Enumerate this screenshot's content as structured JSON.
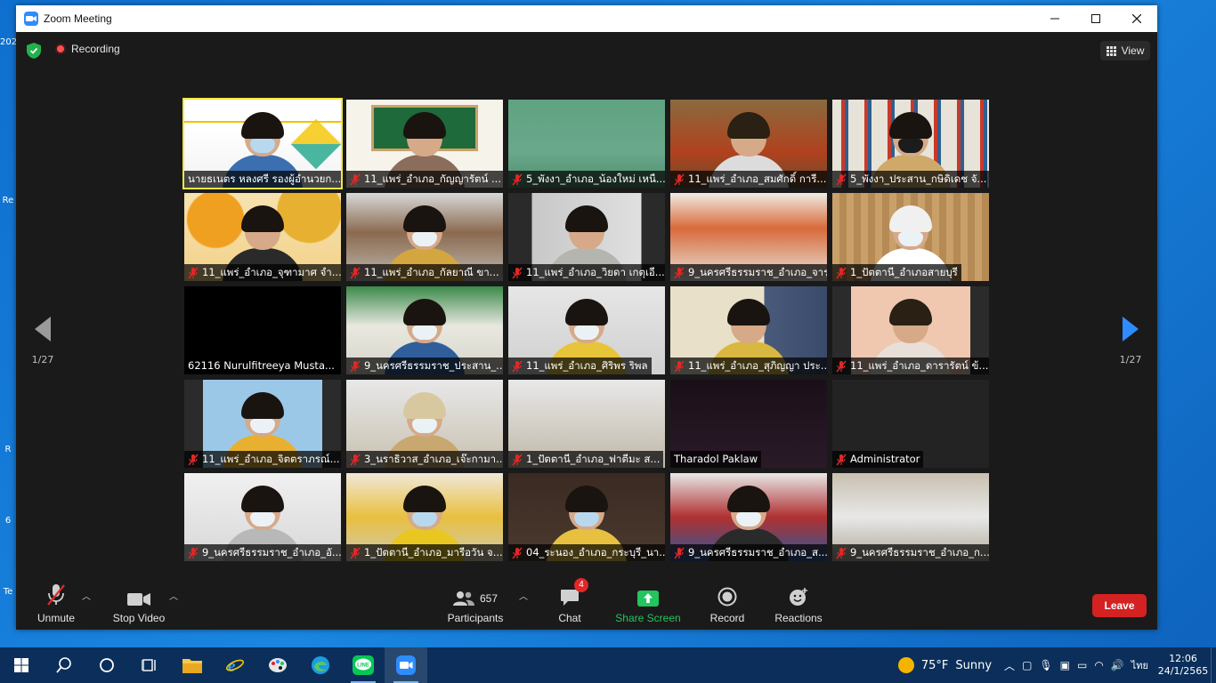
{
  "window": {
    "title": "Zoom Meeting"
  },
  "topbar": {
    "recording_label": "Recording",
    "view_label": "View"
  },
  "nav": {
    "page_left": "1/27",
    "page_right": "1/27"
  },
  "tiles": [
    {
      "name": "นายธเนตร หลงศรี รองผู้อำนวยก...",
      "muted": false,
      "scene": "slide"
    },
    {
      "name": "11_แพร่_อำเภอ_กัญญารัตน์ ...",
      "muted": true,
      "scene": "board"
    },
    {
      "name": "5_พังงา_อำเภอ_น้องใหม่ เหนื...",
      "muted": true,
      "scene": "green"
    },
    {
      "name": "11_แพร่_อำเภอ_สมศักดิ์ การี...",
      "muted": true,
      "scene": "temple"
    },
    {
      "name": "5_พังงา_ประสาน_กษิดิเดช จั...",
      "muted": true,
      "scene": "books"
    },
    {
      "name": "11_แพร่_อำเภอ_จุฑามาศ จำ...",
      "muted": true,
      "scene": "autumn"
    },
    {
      "name": "11_แพร่_อำเภอ_กัลยาณี ขา...",
      "muted": true,
      "scene": "room"
    },
    {
      "name": "11_แพร่_อำเภอ_วิยดา เกตุเอี...",
      "muted": true,
      "scene": "office"
    },
    {
      "name": "9_นครศรีธรรมราช_อำเภอ_จารุ...",
      "muted": true,
      "scene": "shelf"
    },
    {
      "name": "1_ปัตตานี_อำเภอสายบุรี",
      "muted": true,
      "scene": "curtain"
    },
    {
      "name": "62116 Nurulfitreeya Musta...",
      "muted": false,
      "scene": "black"
    },
    {
      "name": "9_นครศรีธรรมราช_ประสาน_...",
      "muted": true,
      "scene": "poster"
    },
    {
      "name": "11_แพร่_อำเภอ_ศิริพร ริพล",
      "muted": true,
      "scene": "office2"
    },
    {
      "name": "11_แพร่_อำเภอ_สุภิญญา ประ...",
      "muted": true,
      "scene": "files"
    },
    {
      "name": "11_แพร่_อำเภอ_ดารารัตน์ ข้...",
      "muted": true,
      "scene": "pink"
    },
    {
      "name": "11_แพร่_อำเภอ_จิตตราภรณ์...",
      "muted": true,
      "scene": "window"
    },
    {
      "name": "3_นราธิวาส_อำเภอ_เจ๊ะกามา...",
      "muted": true,
      "scene": "hall"
    },
    {
      "name": "1_ปัตตานี_อำเภอ_ฟาตีมะ ส...",
      "muted": true,
      "scene": "ceiling"
    },
    {
      "name": "Tharadol Paklaw",
      "muted": false,
      "scene": "dark"
    },
    {
      "name": "Administrator",
      "muted": true,
      "scene": "empty"
    },
    {
      "name": "9_นครศรีธรรมราช_อำเภอ_อั...",
      "muted": true,
      "scene": "wall"
    },
    {
      "name": "1_ปัตตานี_อำเภอ_มารีอวัน จ...",
      "muted": true,
      "scene": "class"
    },
    {
      "name": "04_ระนอง_อำเภอ_กระบุรี_นา...",
      "muted": true,
      "scene": "darkroom"
    },
    {
      "name": "9_นครศรีธรรมราช_อำเภอ_ส...",
      "muted": true,
      "scene": "board2"
    },
    {
      "name": "9_นครศรีธรรมราช_อำเภอ_ก...",
      "muted": true,
      "scene": "screen"
    }
  ],
  "toolbar": {
    "unmute": "Unmute",
    "stop_video": "Stop Video",
    "participants": "Participants",
    "participant_count": "657",
    "chat": "Chat",
    "chat_badge": "4",
    "share_screen": "Share Screen",
    "record": "Record",
    "reactions": "Reactions",
    "leave": "Leave"
  },
  "taskbar": {
    "temperature": "75°F",
    "weather": "Sunny",
    "lang": "ไทย",
    "time": "12:06",
    "date": "24/1/2565"
  },
  "colors": {
    "zoom_blue": "#2d8cff",
    "leave_red": "#d42222",
    "share_green": "#22c55e",
    "active_speaker": "#f4e642"
  }
}
